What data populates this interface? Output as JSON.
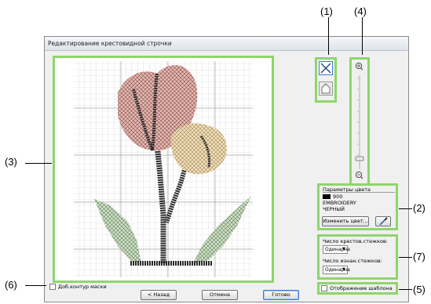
{
  "window": {
    "title": "Редактирование крестовидной строчки"
  },
  "callouts": {
    "c1": "(1)",
    "c2": "(2)",
    "c3": "(3)",
    "c4": "(4)",
    "c5": "(5)",
    "c6": "(6)",
    "c7": "(7)"
  },
  "color_params": {
    "heading": "Параметры цвета",
    "code": "900",
    "line1": "EMBROIDERY",
    "line2": "ЧЕРНЫЙ",
    "change_button": "Изменить цвет...",
    "swatch_color": "#000000"
  },
  "stitches": {
    "cross_label": "Число крестов.стежков:",
    "cross_value": "Одинарна",
    "reverse_label": "Число изнан.стежков:",
    "reverse_value": "Одинарна"
  },
  "template": {
    "label": "Отображение шаблона"
  },
  "mask": {
    "label": "Доб.контур маски"
  },
  "buttons": {
    "back": "< Назад",
    "cancel": "Отмена",
    "done": "Готово"
  },
  "colors": {
    "highlight": "#8ed66a",
    "petal_fill": "#f4b8b0",
    "bud_fill": "#fbe3b4",
    "leaf_fill": "#cfe9c5",
    "stitch": "#333333"
  }
}
